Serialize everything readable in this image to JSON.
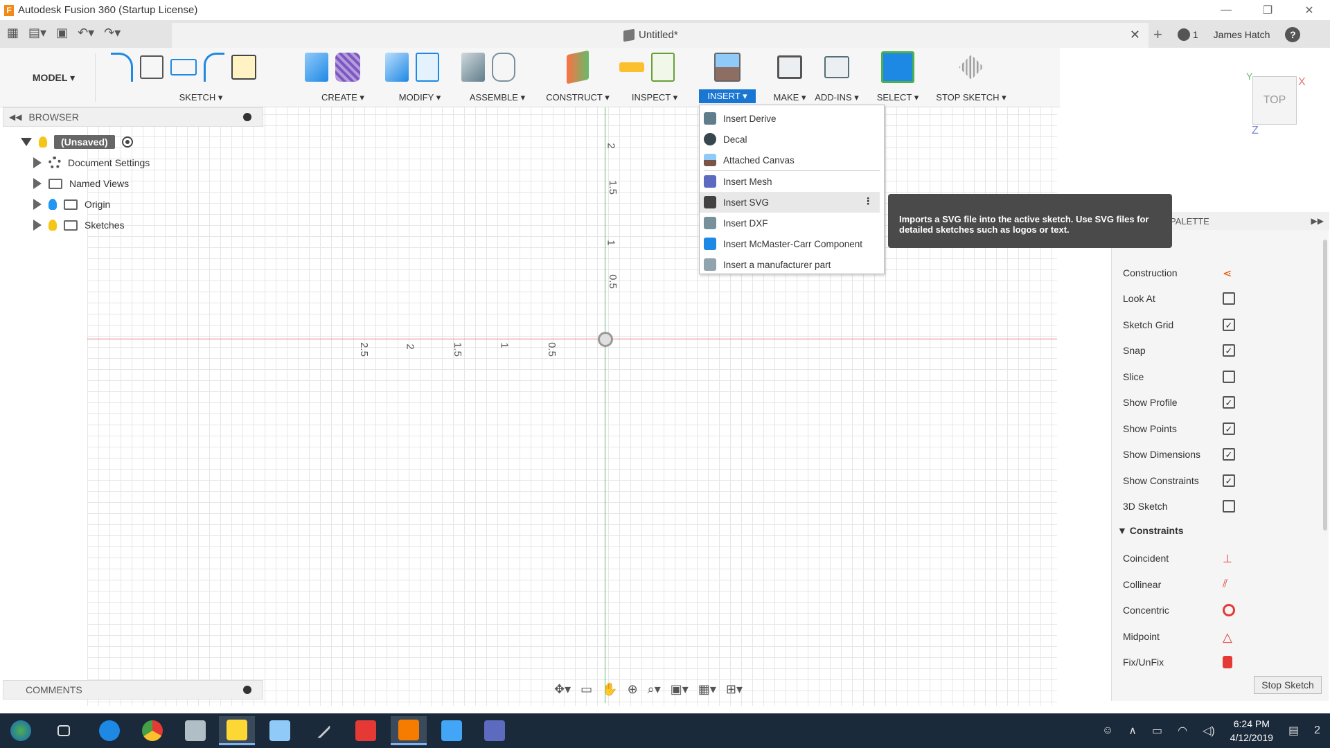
{
  "window": {
    "title": "Autodesk Fusion 360 (Startup License)",
    "controls": [
      "—",
      "❐",
      "✕"
    ]
  },
  "quickaccess": {
    "doc_title": "Untitled*",
    "close": "✕",
    "plus": "+",
    "job_count": "1",
    "user": "James Hatch",
    "help": "?"
  },
  "toolbar": {
    "workspace": "MODEL ▾",
    "groups": [
      {
        "label": "SKETCH ▾"
      },
      {
        "label": "CREATE ▾"
      },
      {
        "label": "MODIFY ▾"
      },
      {
        "label": "ASSEMBLE ▾"
      },
      {
        "label": "CONSTRUCT ▾"
      },
      {
        "label": "INSPECT ▾"
      },
      {
        "label": "INSERT ▾"
      },
      {
        "label": "MAKE ▾"
      },
      {
        "label": "ADD-INS ▾"
      },
      {
        "label": "SELECT ▾"
      },
      {
        "label": "STOP SKETCH ▾"
      }
    ],
    "active_group": "INSERT ▾",
    "accent": "#1976d2"
  },
  "browser": {
    "header": "BROWSER",
    "items": [
      {
        "label": "(Unsaved)"
      },
      {
        "label": "Document Settings"
      },
      {
        "label": "Named Views"
      },
      {
        "label": "Origin"
      },
      {
        "label": "Sketches"
      }
    ]
  },
  "insert_menu": {
    "items": [
      {
        "label": "Insert Derive"
      },
      {
        "label": "Decal"
      },
      {
        "label": "Attached Canvas"
      },
      {
        "label": "Insert Mesh"
      },
      {
        "label": "Insert SVG"
      },
      {
        "label": "Insert DXF"
      },
      {
        "label": "Insert McMaster-Carr Component"
      },
      {
        "label": "Insert a manufacturer part"
      }
    ],
    "highlighted": "Insert SVG"
  },
  "tooltip": {
    "text": "Imports a SVG file into the active sketch. Use SVG files for detailed sketches such as logos or text."
  },
  "viewcube": {
    "face": "TOP",
    "x": "X",
    "y": "Y",
    "z": "Z"
  },
  "canvas": {
    "v_ticks": [
      "2",
      "1.5",
      "1",
      "0.5"
    ],
    "h_ticks": [
      "2.5",
      "2",
      "1.5",
      "1",
      "0.5"
    ]
  },
  "palette": {
    "header": "PALETTE",
    "options": [
      {
        "label": "Construction",
        "type": "icon"
      },
      {
        "label": "Look At",
        "type": "icon"
      },
      {
        "label": "Sketch Grid",
        "type": "check",
        "checked": "✓"
      },
      {
        "label": "Snap",
        "type": "check",
        "checked": "✓"
      },
      {
        "label": "Slice",
        "type": "check",
        "checked": ""
      },
      {
        "label": "Show Profile",
        "type": "check",
        "checked": "✓"
      },
      {
        "label": "Show Points",
        "type": "check",
        "checked": "✓"
      },
      {
        "label": "Show Dimensions",
        "type": "check",
        "checked": "✓"
      },
      {
        "label": "Show Constraints",
        "type": "check",
        "checked": "✓"
      },
      {
        "label": "3D Sketch",
        "type": "check",
        "checked": ""
      }
    ],
    "constraints_header": "Constraints",
    "constraints": [
      {
        "label": "Coincident"
      },
      {
        "label": "Collinear"
      },
      {
        "label": "Concentric"
      },
      {
        "label": "Midpoint"
      },
      {
        "label": "Fix/UnFix"
      }
    ],
    "stop_button": "Stop Sketch"
  },
  "comments": {
    "header": "COMMENTS"
  },
  "taskbar": {
    "time": "6:24 PM",
    "date": "4/12/2019",
    "notifications": "2"
  }
}
